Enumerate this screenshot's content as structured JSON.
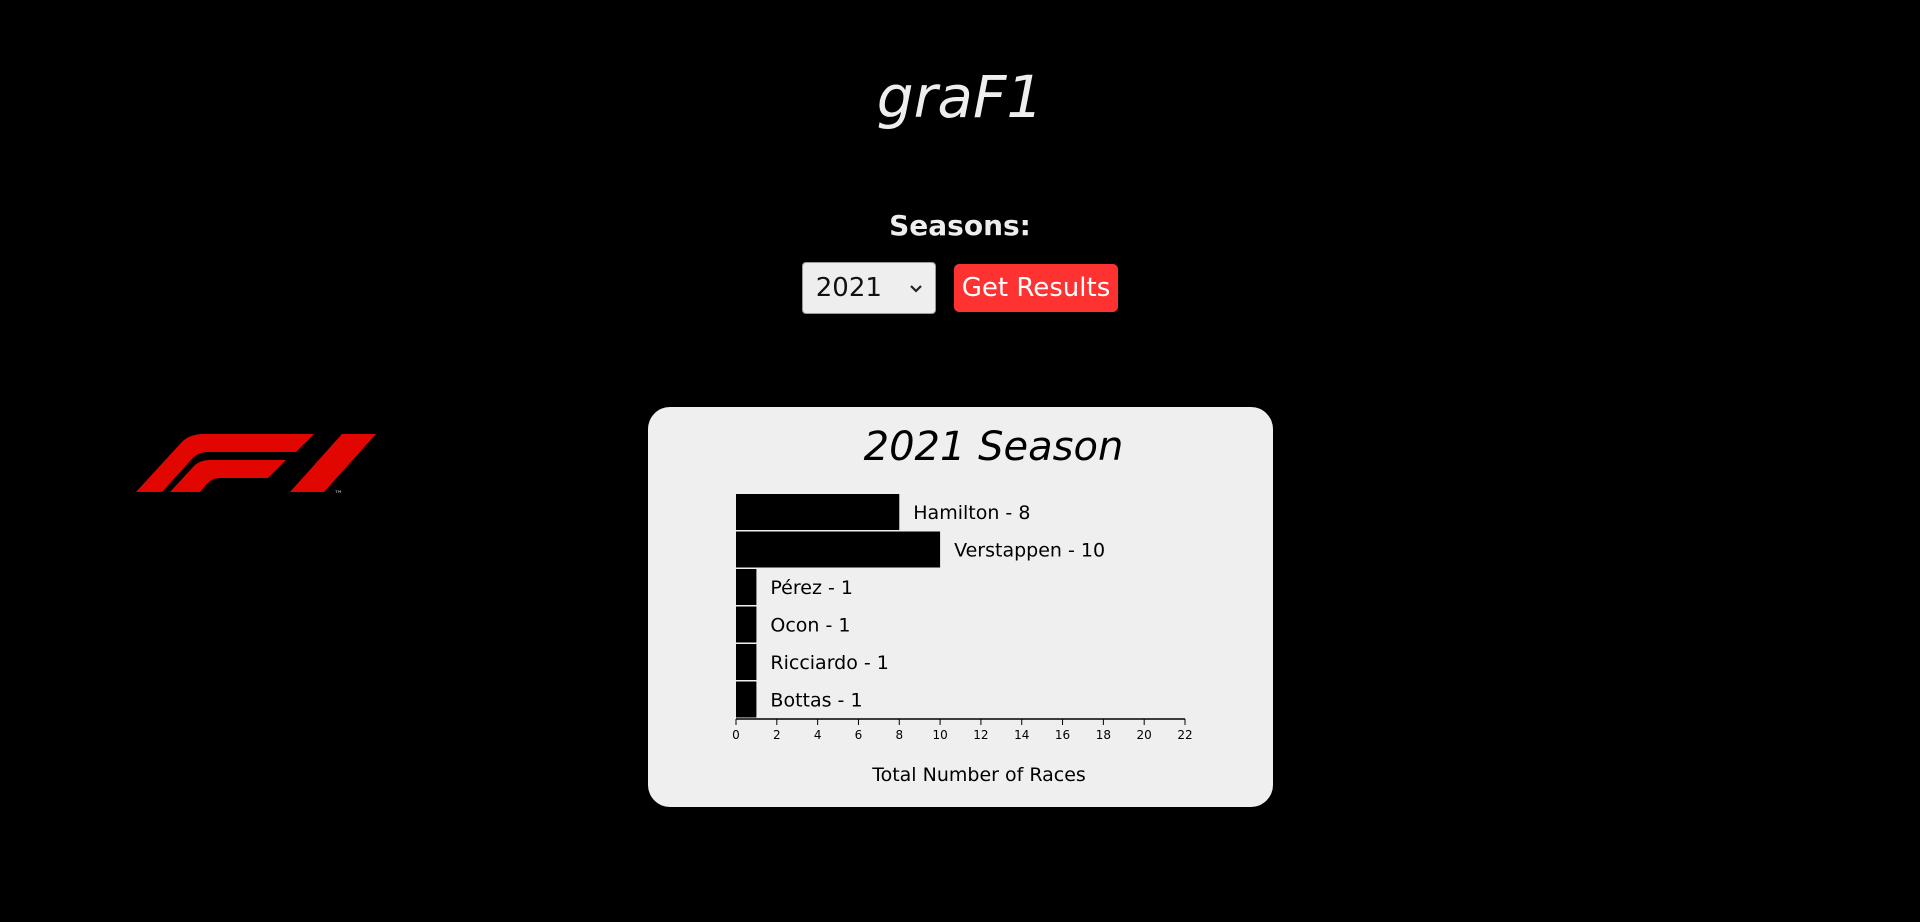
{
  "app": {
    "title": "graF1"
  },
  "controls": {
    "seasons_label": "Seasons:",
    "selected_season": "2021",
    "get_results_label": "Get Results"
  },
  "colors": {
    "background": "#000000",
    "accent_button": "#ff3232",
    "card": "#efefef",
    "logo_red": "#e10600",
    "bar": "#000000"
  },
  "chart_data": {
    "type": "bar",
    "orientation": "horizontal",
    "title": "2021 Season",
    "xlabel": "Total Number of Races",
    "ylabel": "",
    "xlim": [
      0,
      22
    ],
    "x_ticks": [
      0,
      2,
      4,
      6,
      8,
      10,
      12,
      14,
      16,
      18,
      20,
      22
    ],
    "categories": [
      "Hamilton",
      "Verstappen",
      "Pérez",
      "Ocon",
      "Ricciardo",
      "Bottas"
    ],
    "values": [
      8,
      10,
      1,
      1,
      1,
      1
    ],
    "bar_labels": [
      "Hamilton - 8",
      "Verstappen - 10",
      "Pérez - 1",
      "Ocon - 1",
      "Ricciardo - 1",
      "Bottas - 1"
    ],
    "grid": false,
    "legend": "none"
  }
}
